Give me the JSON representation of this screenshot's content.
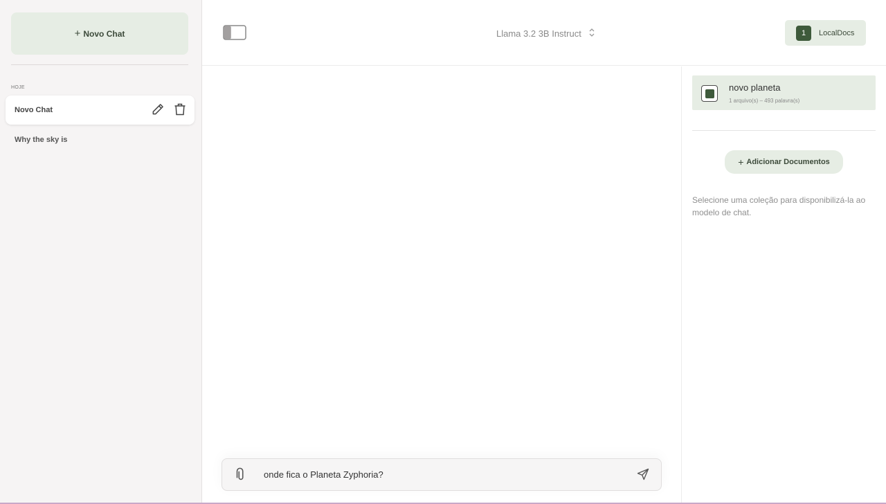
{
  "sidebar": {
    "new_chat_label": "Novo Chat",
    "section_label": "HOJE",
    "chats": [
      {
        "label": "Novo Chat"
      },
      {
        "label": "Why the sky is"
      }
    ]
  },
  "header": {
    "model_name": "Llama 3.2 3B Instruct",
    "localdocs_count": "1",
    "localdocs_label": "LocalDocs"
  },
  "chat": {
    "input_value": "onde fica o Planeta Zyphoria?"
  },
  "localdocs_panel": {
    "collections": [
      {
        "name": "novo planeta",
        "meta": "1 arquivo(s) – 493 palavra(s)",
        "selected": true
      }
    ],
    "add_documents_label": "Adicionar Documentos",
    "hint": "Selecione uma coleção para disponibilizá-la ao modelo de chat."
  },
  "colors": {
    "accent_green": "#3e5a3b",
    "light_green": "#e6ede4",
    "sidebar_bg": "#f6f4f4"
  },
  "icons": [
    "plus-icon",
    "edit-icon",
    "trash-icon",
    "sidebar-toggle-icon",
    "chevron-updown-icon",
    "paperclip-icon",
    "send-icon"
  ]
}
